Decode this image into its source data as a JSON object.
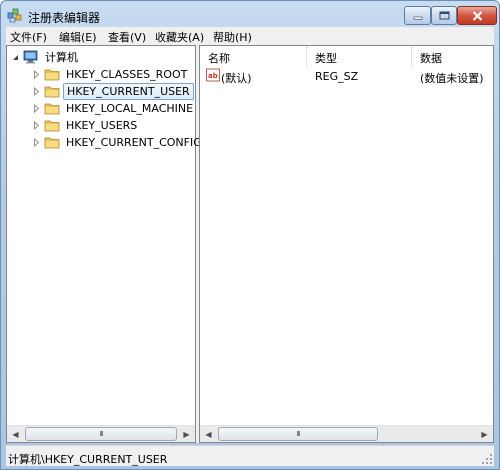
{
  "window": {
    "title": "注册表编辑器"
  },
  "menubar": {
    "items": [
      "文件(F)",
      "编辑(E)",
      "查看(V)",
      "收藏夹(A)",
      "帮助(H)"
    ]
  },
  "tree": {
    "root": {
      "label": "计算机",
      "icon": "computer-icon",
      "expanded": true
    },
    "items": [
      {
        "label": "HKEY_CLASSES_ROOT",
        "icon": "folder-icon",
        "selected": false
      },
      {
        "label": "HKEY_CURRENT_USER",
        "icon": "folder-icon",
        "selected": true
      },
      {
        "label": "HKEY_LOCAL_MACHINE",
        "icon": "folder-icon",
        "selected": false
      },
      {
        "label": "HKEY_USERS",
        "icon": "folder-icon",
        "selected": false
      },
      {
        "label": "HKEY_CURRENT_CONFIG",
        "icon": "folder-icon",
        "selected": false
      }
    ]
  },
  "list": {
    "columns": [
      "名称",
      "类型",
      "数据"
    ],
    "rows": [
      {
        "name": "(默认)",
        "type": "REG_SZ",
        "data": "(数值未设置)",
        "icon": "string-value-icon"
      }
    ]
  },
  "scrollbars": {
    "thumb_glyph": "III"
  },
  "status": {
    "path": "计算机\\HKEY_CURRENT_USER"
  },
  "colors": {
    "title_bg": "#b9d1ea",
    "selection_border": "#7da2ce",
    "close_button": "#c8432b"
  }
}
